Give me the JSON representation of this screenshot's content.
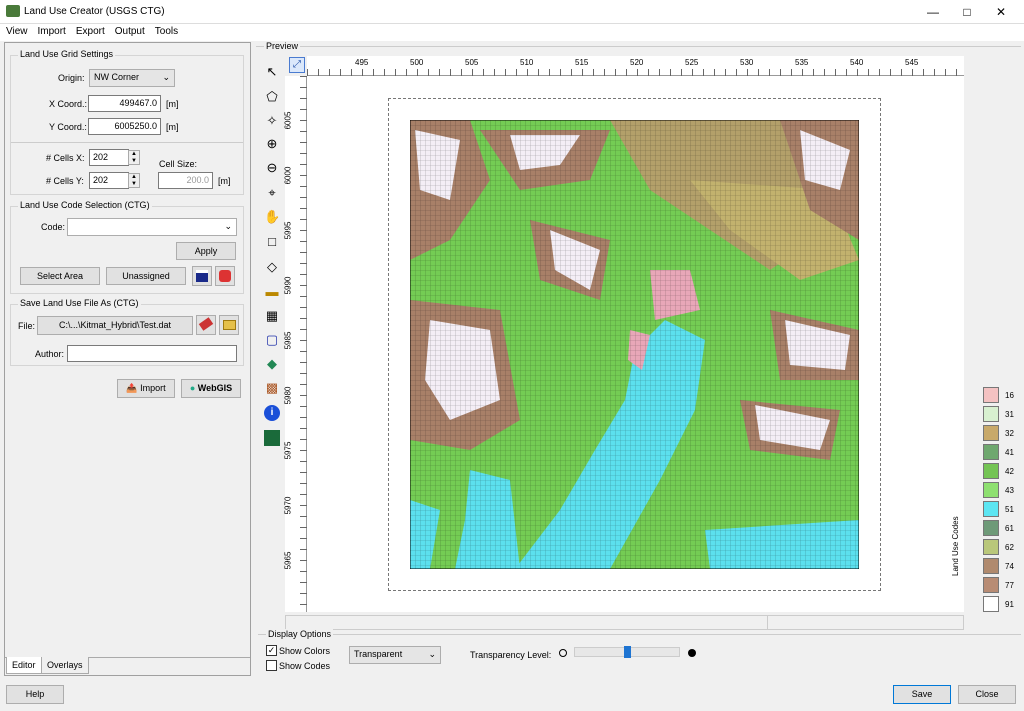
{
  "window": {
    "title": "Land Use Creator (USGS CTG)"
  },
  "menu": [
    "View",
    "Import",
    "Export",
    "Output",
    "Tools"
  ],
  "grid_settings": {
    "title": "Land Use Grid Settings",
    "origin_label": "Origin:",
    "origin_value": "NW Corner",
    "x_label": "X Coord.:",
    "x_value": "499467.0",
    "x_unit": "[m]",
    "y_label": "Y Coord.:",
    "y_value": "6005250.0",
    "y_unit": "[m]",
    "cells_x_label": "# Cells X:",
    "cells_x_value": "202",
    "cells_y_label": "# Cells Y:",
    "cells_y_value": "202",
    "cell_size_label": "Cell Size:",
    "cell_size_value": "200.0",
    "cell_size_unit": "[m]"
  },
  "code_selection": {
    "title": "Land Use Code Selection (CTG)",
    "code_label": "Code:",
    "code_value": "",
    "apply_label": "Apply",
    "select_area_label": "Select Area",
    "unassigned_label": "Unassigned"
  },
  "save_file": {
    "title": "Save Land Use File As (CTG)",
    "file_label": "File:",
    "file_value": "C:\\...\\Kitmat_Hybrid\\Test.dat",
    "author_label": "Author:",
    "author_value": ""
  },
  "actions": {
    "import_label": "Import",
    "webgis_label": "WebGIS"
  },
  "tabs": [
    "Editor",
    "Overlays"
  ],
  "preview": {
    "label": "Preview",
    "x_ticks": [
      "495",
      "500",
      "505",
      "510",
      "515",
      "520",
      "525",
      "530",
      "535",
      "540",
      "545"
    ],
    "y_ticks": [
      "6005",
      "6000",
      "5995",
      "5990",
      "5985",
      "5980",
      "5975",
      "5970",
      "5965"
    ]
  },
  "legend": {
    "title": "Land Use Codes",
    "items": [
      {
        "code": "16",
        "color": "#f4c2c2"
      },
      {
        "code": "31",
        "color": "#d8f0d0"
      },
      {
        "code": "32",
        "color": "#c8a96a"
      },
      {
        "code": "41",
        "color": "#6fa86f"
      },
      {
        "code": "42",
        "color": "#74c454"
      },
      {
        "code": "43",
        "color": "#8ee070"
      },
      {
        "code": "51",
        "color": "#5ce6f2"
      },
      {
        "code": "61",
        "color": "#6e9a78"
      },
      {
        "code": "62",
        "color": "#b9c77a"
      },
      {
        "code": "74",
        "color": "#b08a6e"
      },
      {
        "code": "77",
        "color": "#b88c74"
      },
      {
        "code": "91",
        "color": "#ffffff"
      }
    ]
  },
  "display_options": {
    "title": "Display Options",
    "show_colors_label": "Show Colors",
    "show_colors_checked": true,
    "show_codes_label": "Show Codes",
    "show_codes_checked": false,
    "mode_value": "Transparent",
    "transparency_label": "Transparency Level:",
    "transparency_level": 0.5
  },
  "footer": {
    "help_label": "Help",
    "save_label": "Save",
    "close_label": "Close"
  }
}
